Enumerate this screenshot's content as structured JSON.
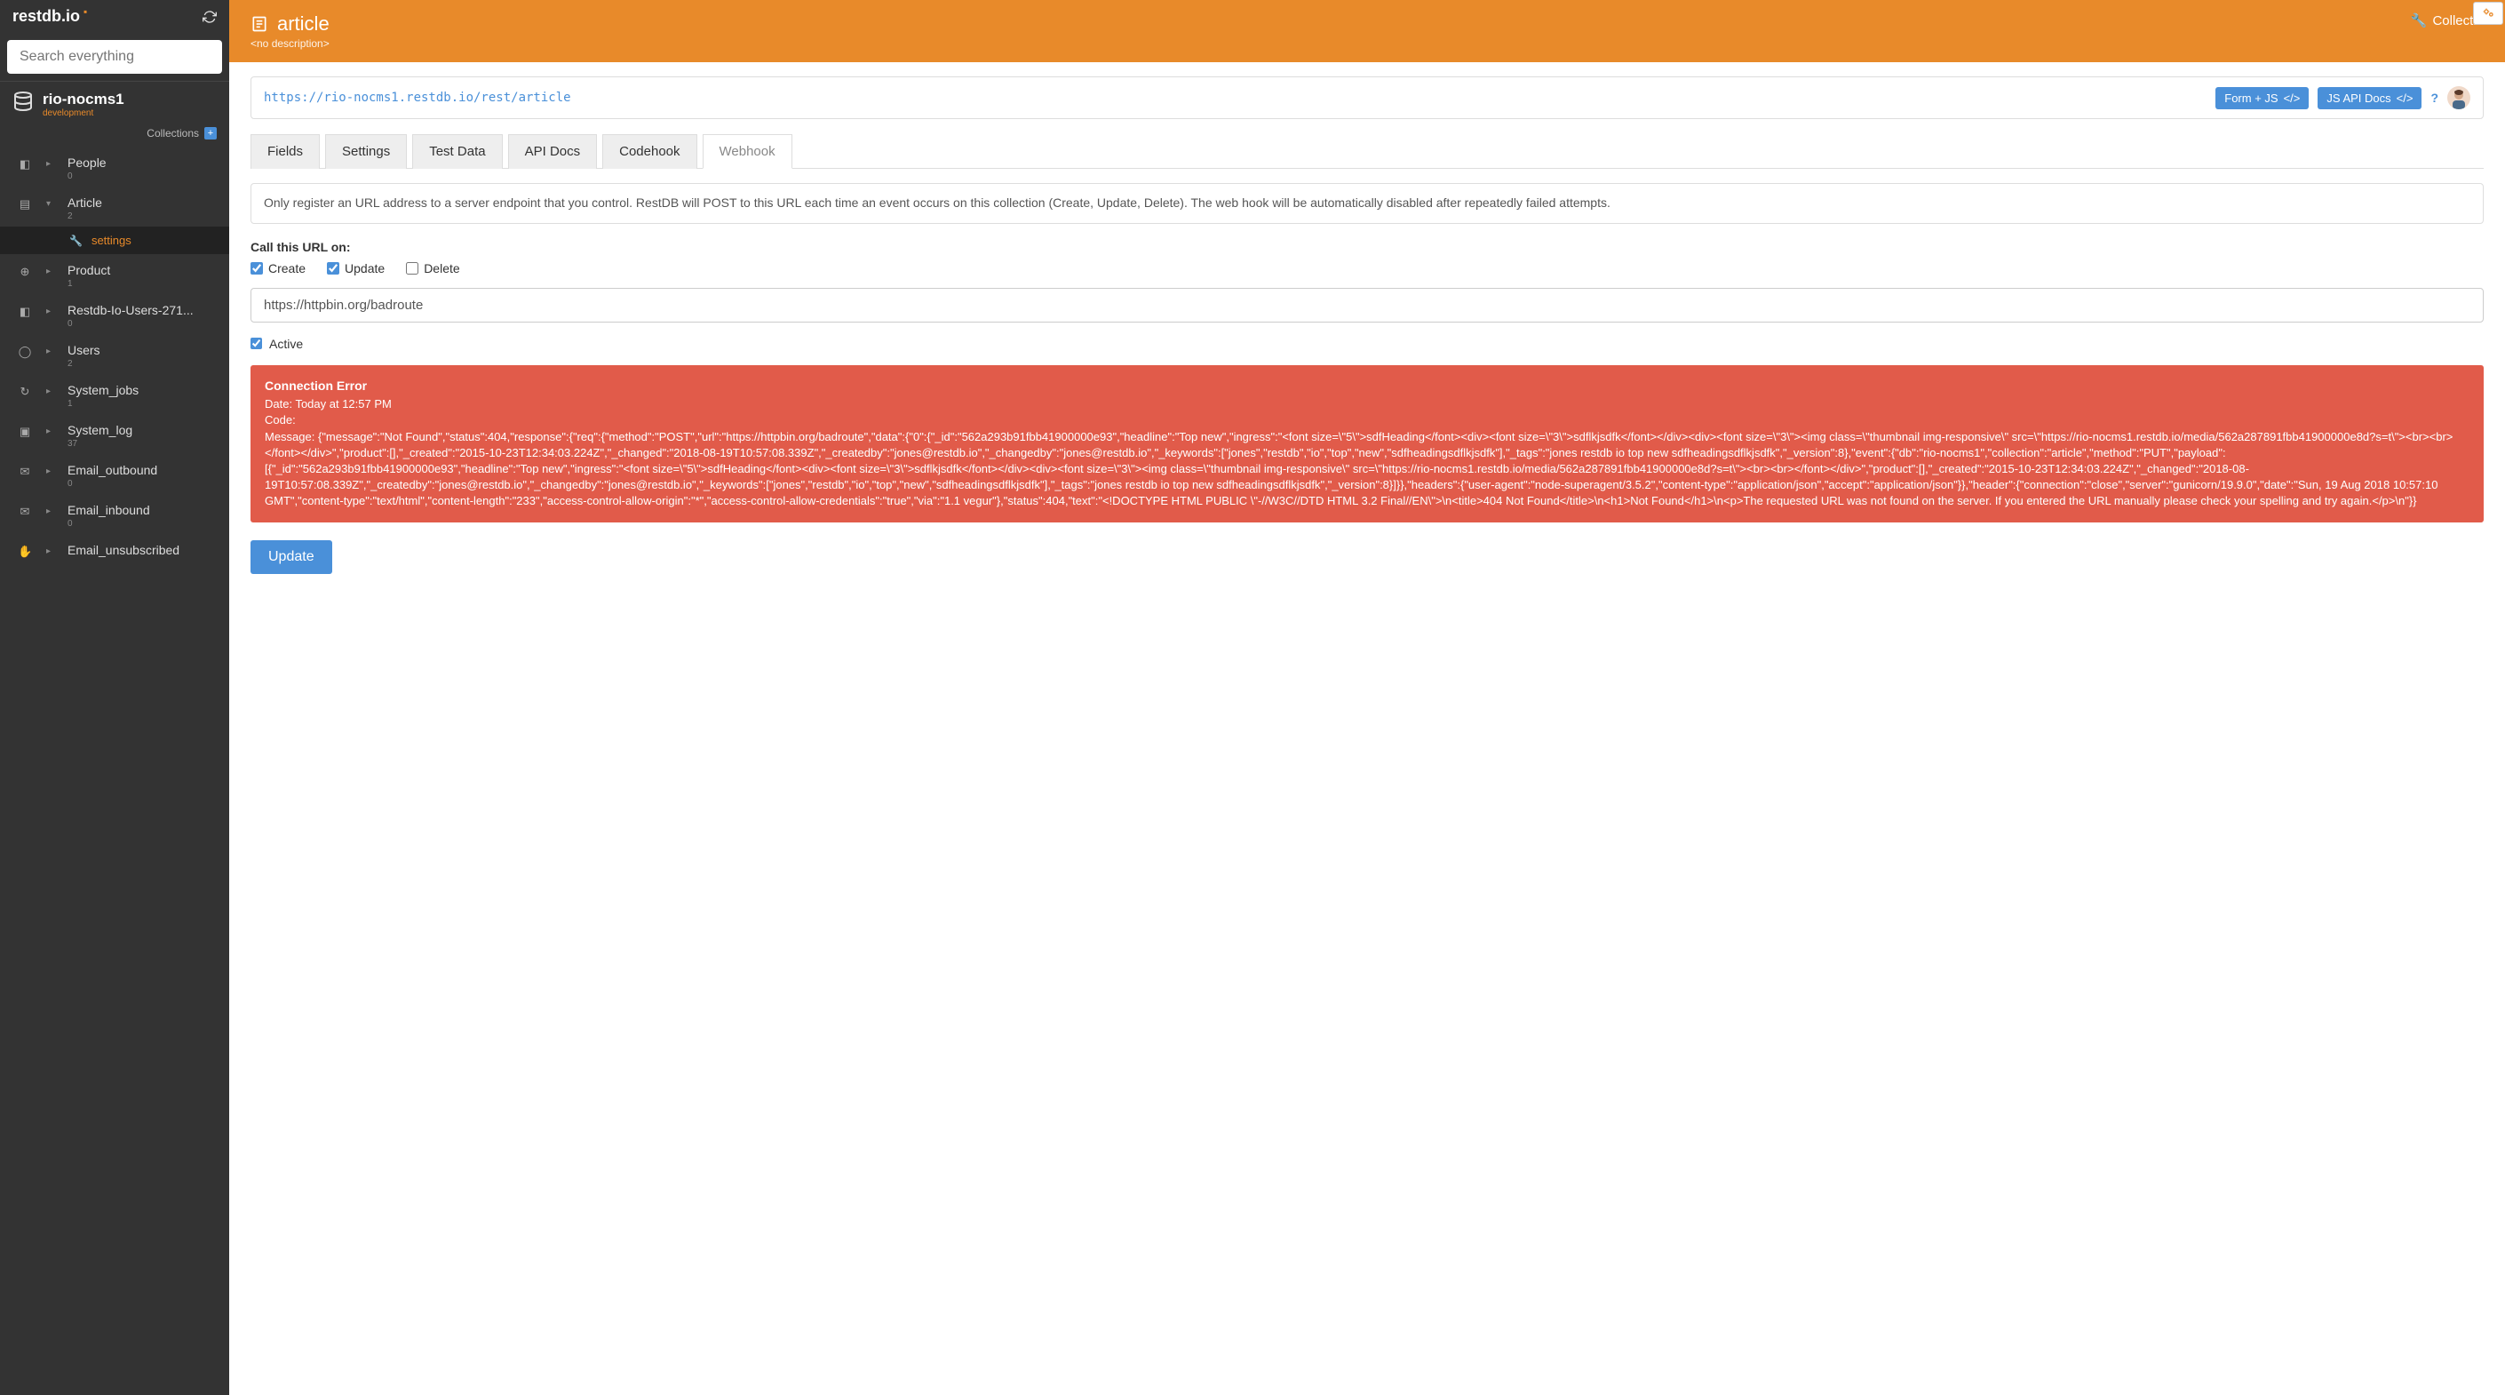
{
  "brand": "restdb.io",
  "search": {
    "placeholder": "Search everything"
  },
  "db": {
    "name": "rio-nocms1",
    "env": "development"
  },
  "sidebar": {
    "collections_label": "Collections",
    "items": [
      {
        "label": "People",
        "count": "0",
        "icon": "◧"
      },
      {
        "label": "Article",
        "count": "2",
        "icon": "▤",
        "expanded": true
      },
      {
        "label": "Product",
        "count": "1",
        "icon": "⊕"
      },
      {
        "label": "Restdb-Io-Users-271...",
        "count": "0",
        "icon": "◧"
      },
      {
        "label": "Users",
        "count": "2",
        "icon": "◯"
      },
      {
        "label": "System_jobs",
        "count": "1",
        "icon": "↻"
      },
      {
        "label": "System_log",
        "count": "37",
        "icon": "▣"
      },
      {
        "label": "Email_outbound",
        "count": "0",
        "icon": "✉"
      },
      {
        "label": "Email_inbound",
        "count": "0",
        "icon": "✉"
      },
      {
        "label": "Email_unsubscribed",
        "count": "",
        "icon": "✋"
      }
    ],
    "subitem": {
      "label": "settings"
    }
  },
  "header": {
    "title": "article",
    "desc": "<no description>",
    "collection_btn": "Collectio"
  },
  "urlbar": {
    "url": "https://rio-nocms1.restdb.io/rest/article",
    "form_js": "Form + JS",
    "api_docs": "JS API Docs"
  },
  "tabs": [
    {
      "label": "Fields"
    },
    {
      "label": "Settings"
    },
    {
      "label": "Test Data"
    },
    {
      "label": "API Docs"
    },
    {
      "label": "Codehook"
    },
    {
      "label": "Webhook",
      "active": true
    }
  ],
  "info_text": "Only register an URL address to a server endpoint that you control. RestDB will POST to this URL each time an event occurs on this collection (Create, Update, Delete). The web hook will be automatically disabled after repeatedly failed attempts.",
  "form": {
    "call_label": "Call this URL on:",
    "create": "Create",
    "update": "Update",
    "delete": "Delete",
    "create_checked": true,
    "update_checked": true,
    "delete_checked": false,
    "url_value": "https://httpbin.org/badroute",
    "active": "Active",
    "active_checked": true
  },
  "error": {
    "title": "Connection Error",
    "date": "Date: Today at 12:57 PM",
    "code": "Code:",
    "message": "Message: {\"message\":\"Not Found\",\"status\":404,\"response\":{\"req\":{\"method\":\"POST\",\"url\":\"https://httpbin.org/badroute\",\"data\":{\"0\":{\"_id\":\"562a293b91fbb41900000e93\",\"headline\":\"Top new\",\"ingress\":\"<font size=\\\"5\\\">sdfHeading</font><div><font size=\\\"3\\\">sdflkjsdfk</font></div><div><font size=\\\"3\\\"><img class=\\\"thumbnail img-responsive\\\" src=\\\"https://rio-nocms1.restdb.io/media/562a287891fbb41900000e8d?s=t\\\"><br><br></font></div>\",\"product\":[],\"_created\":\"2015-10-23T12:34:03.224Z\",\"_changed\":\"2018-08-19T10:57:08.339Z\",\"_createdby\":\"jones@restdb.io\",\"_changedby\":\"jones@restdb.io\",\"_keywords\":[\"jones\",\"restdb\",\"io\",\"top\",\"new\",\"sdfheadingsdflkjsdfk\"],\"_tags\":\"jones restdb io top new sdfheadingsdflkjsdfk\",\"_version\":8},\"event\":{\"db\":\"rio-nocms1\",\"collection\":\"article\",\"method\":\"PUT\",\"payload\":[{\"_id\":\"562a293b91fbb41900000e93\",\"headline\":\"Top new\",\"ingress\":\"<font size=\\\"5\\\">sdfHeading</font><div><font size=\\\"3\\\">sdflkjsdfk</font></div><div><font size=\\\"3\\\"><img class=\\\"thumbnail img-responsive\\\" src=\\\"https://rio-nocms1.restdb.io/media/562a287891fbb41900000e8d?s=t\\\"><br><br></font></div>\",\"product\":[],\"_created\":\"2015-10-23T12:34:03.224Z\",\"_changed\":\"2018-08-19T10:57:08.339Z\",\"_createdby\":\"jones@restdb.io\",\"_changedby\":\"jones@restdb.io\",\"_keywords\":[\"jones\",\"restdb\",\"io\",\"top\",\"new\",\"sdfheadingsdflkjsdfk\"],\"_tags\":\"jones restdb io top new sdfheadingsdflkjsdfk\",\"_version\":8}]}},\"headers\":{\"user-agent\":\"node-superagent/3.5.2\",\"content-type\":\"application/json\",\"accept\":\"application/json\"}},\"header\":{\"connection\":\"close\",\"server\":\"gunicorn/19.9.0\",\"date\":\"Sun, 19 Aug 2018 10:57:10 GMT\",\"content-type\":\"text/html\",\"content-length\":\"233\",\"access-control-allow-origin\":\"*\",\"access-control-allow-credentials\":\"true\",\"via\":\"1.1 vegur\"},\"status\":404,\"text\":\"<!DOCTYPE HTML PUBLIC \\\"-//W3C//DTD HTML 3.2 Final//EN\\\">\\n<title>404 Not Found</title>\\n<h1>Not Found</h1>\\n<p>The requested URL was not found on the server. If you entered the URL manually please check your spelling and try again.</p>\\n\"}}"
  },
  "update_btn": "Update"
}
